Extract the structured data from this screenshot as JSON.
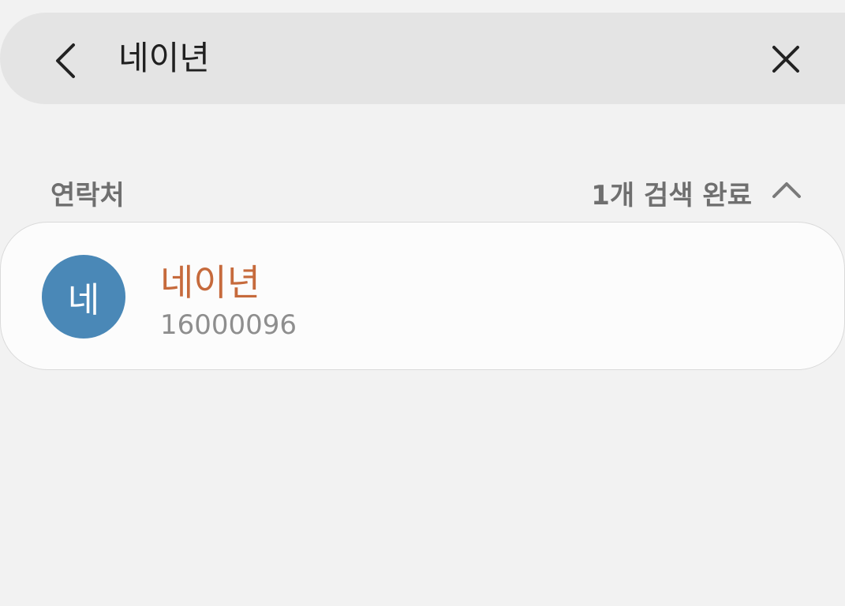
{
  "search": {
    "query": "네이년",
    "back_icon": "chevron-left-icon",
    "clear_icon": "close-icon"
  },
  "section": {
    "title": "연락처",
    "result_count": "1개 검색 완료",
    "collapse_icon": "chevron-up-icon"
  },
  "contacts": [
    {
      "avatar_initial": "네",
      "avatar_color": "#4a88b7",
      "name": "네이년",
      "name_color": "#c66a3c",
      "number": "16000096"
    }
  ],
  "colors": {
    "background": "#f2f2f2",
    "search_bar": "#e4e4e4",
    "card": "#fcfcfc",
    "secondary_text": "#6f6f6f"
  }
}
